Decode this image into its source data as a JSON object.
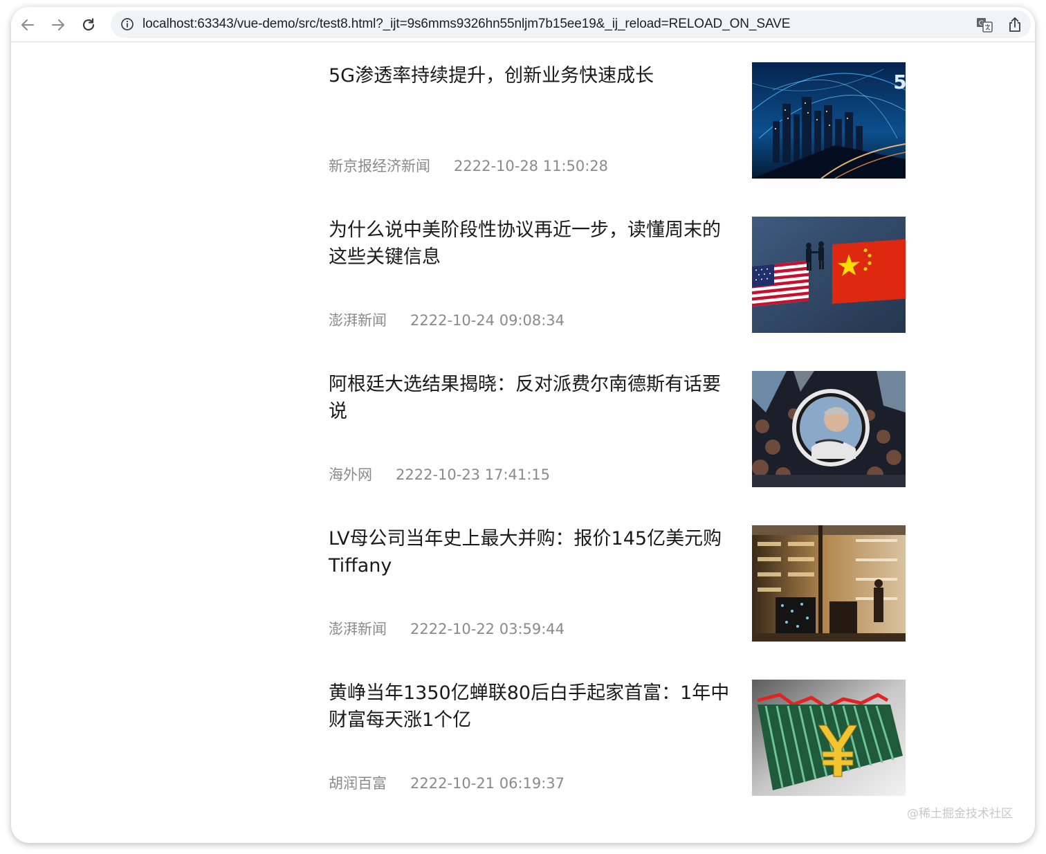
{
  "browser": {
    "url": "localhost:63343/vue-demo/src/test8.html?_ijt=9s6mms9326hn55nljm7b15ee19&_ij_reload=RELOAD_ON_SAVE"
  },
  "news": [
    {
      "title": "5G渗透率持续提升，创新业务快速成长",
      "source": "新京报经济新闻",
      "time": "2222-10-28 11:50:28",
      "image": "5g-city-image"
    },
    {
      "title": "为什么说中美阶段性协议再近一步，读懂周末的这些关键信息",
      "source": "澎湃新闻",
      "time": "2222-10-24 09:08:34",
      "image": "us-china-flags-image"
    },
    {
      "title": "阿根廷大选结果揭晓：反对派费尔南德斯有话要说",
      "source": "海外网",
      "time": "2222-10-23 17:41:15",
      "image": "rally-crowd-image"
    },
    {
      "title": "LV母公司当年史上最大并购：报价145亿美元购Tiffany",
      "source": "澎湃新闻",
      "time": "2222-10-22 03:59:44",
      "image": "luxury-store-image"
    },
    {
      "title": "黄峥当年1350亿蝉联80后白手起家首富：1年中财富每天涨1个亿",
      "source": "胡润百富",
      "time": "2222-10-21 06:19:37",
      "image": "yuan-chart-image"
    }
  ],
  "watermark": "@稀土掘金技术社区",
  "colors": {
    "title": "#1a1a1a",
    "meta": "#8a8a8a",
    "toolbar_bg": "#ffffff",
    "url_bg": "#f1f3f4"
  }
}
